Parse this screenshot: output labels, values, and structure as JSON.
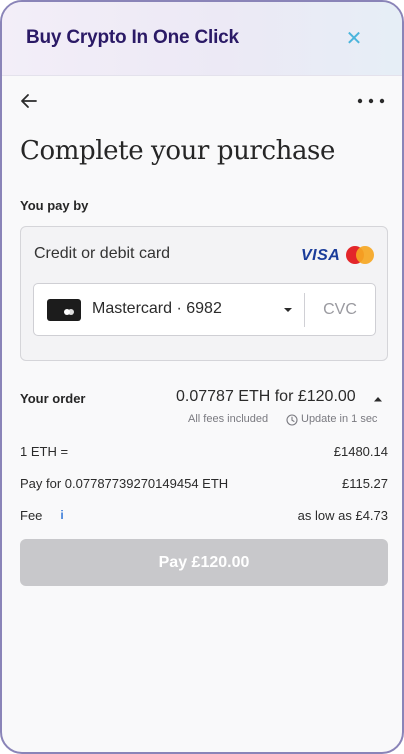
{
  "header": {
    "title": "Buy Crypto In One Click",
    "close_glyph": "✕"
  },
  "page": {
    "title": "Complete your purchase"
  },
  "payment": {
    "section_label": "You pay by",
    "method_label": "Credit or debit card",
    "visa_label": "VISA",
    "selected_card": "Mastercard · 6982",
    "cvc_placeholder": "CVC",
    "cvc_value": ""
  },
  "order": {
    "label": "Your order",
    "summary": "0.07787 ETH for £120.00",
    "fees_note": "All fees included",
    "update_note": "Update in 1 sec",
    "rows": [
      {
        "label": "1 ETH =",
        "value": "£1480.14"
      },
      {
        "label": "Pay for 0.07787739270149454 ETH",
        "value": "£115.27"
      },
      {
        "label": "Fee",
        "value": "as low as £4.73"
      }
    ],
    "info_glyph": "i"
  },
  "cta": {
    "pay_label": "Pay £120.00",
    "enabled": false
  },
  "colors": {
    "brand_title": "#2b1a66",
    "close_icon": "#4ab4dc",
    "button_disabled": "#c8c8cb",
    "info_icon": "#3f7fd9",
    "frame_border": "#8a84b8"
  },
  "icons": {
    "back": "arrow-left-icon",
    "more": "ellipsis-icon",
    "close": "close-icon",
    "card": "card-chip-icon",
    "caret": "chevron-down-icon",
    "order_toggle": "caret-up-icon",
    "clock": "clock-icon",
    "info": "info-icon",
    "visa": "visa-logo",
    "mastercard": "mastercard-logo"
  }
}
